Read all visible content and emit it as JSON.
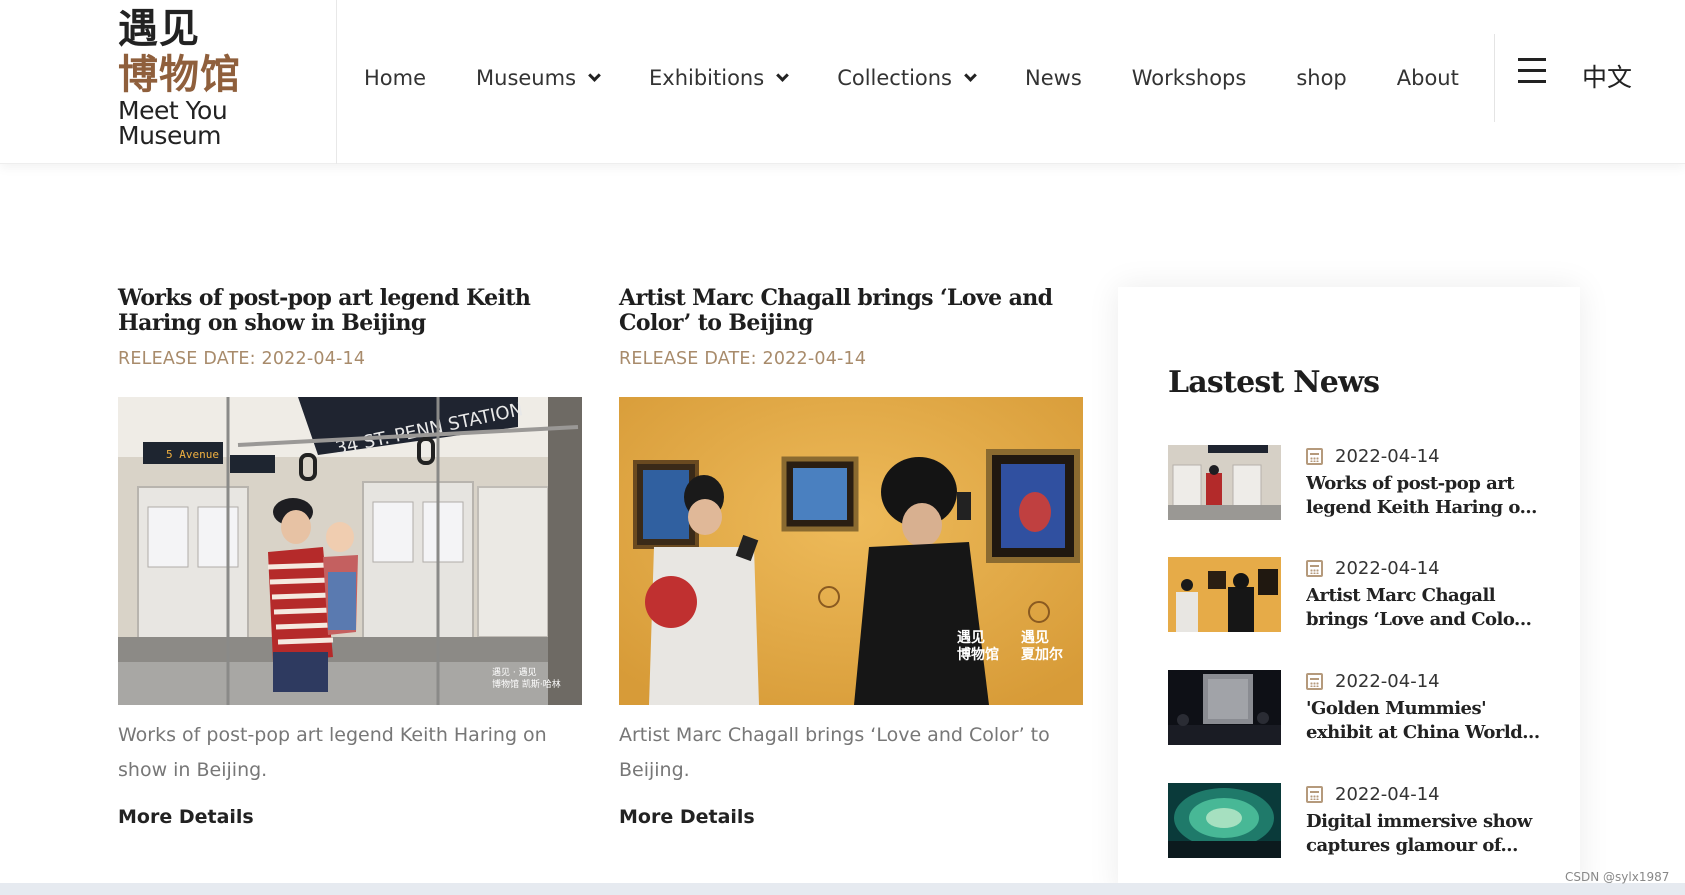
{
  "header": {
    "logo": {
      "cn_line1": "遇见",
      "cn_line2": "博物馆",
      "en_line1": "Meet You",
      "en_line2": "Museum"
    },
    "nav": [
      {
        "label": "Home",
        "dropdown": false
      },
      {
        "label": "Museums",
        "dropdown": true
      },
      {
        "label": "Exhibitions",
        "dropdown": true
      },
      {
        "label": "Collections",
        "dropdown": true
      },
      {
        "label": "News",
        "dropdown": false
      },
      {
        "label": "Workshops",
        "dropdown": false
      },
      {
        "label": "shop",
        "dropdown": false
      },
      {
        "label": "About",
        "dropdown": false
      }
    ],
    "menu_icon": "hamburger-icon",
    "language": "中文"
  },
  "articles": [
    {
      "title": "Works of post-pop art legend Keith Haring on show in Beijing",
      "date": "RELEASE DATE: 2022-04-14",
      "image": "subway-car-exhibit-photo",
      "description": "Works of post-pop art legend Keith Haring on show in Beijing.",
      "more": "More Details"
    },
    {
      "title": "Artist Marc Chagall brings ‘Love and Color’ to Beijing",
      "date": "RELEASE DATE: 2022-04-14",
      "image": "gallery-visitors-photo",
      "description": "Artist Marc Chagall brings ‘Love and Color’ to Beijing.",
      "more": "More Details"
    }
  ],
  "sidebar": {
    "title": "Lastest News",
    "items": [
      {
        "date": "2022-04-14",
        "title_line1": "Works of post-pop art",
        "title_line2": "legend Keith Haring o..."
      },
      {
        "date": "2022-04-14",
        "title_line1": "Artist Marc Chagall",
        "title_line2": "brings ‘Love and Colo..."
      },
      {
        "date": "2022-04-14",
        "title_line1": "'Golden Mummies'",
        "title_line2": "exhibit at China World..."
      },
      {
        "date": "2022-04-14",
        "title_line1": "Digital immersive show",
        "title_line2": "captures glamour of..."
      }
    ]
  },
  "watermark": "CSDN @sylx1987",
  "colors": {
    "date_accent": "#a88b6b",
    "logo_brown": "#8f5f3c",
    "calendar_icon": "#b59a7c"
  }
}
